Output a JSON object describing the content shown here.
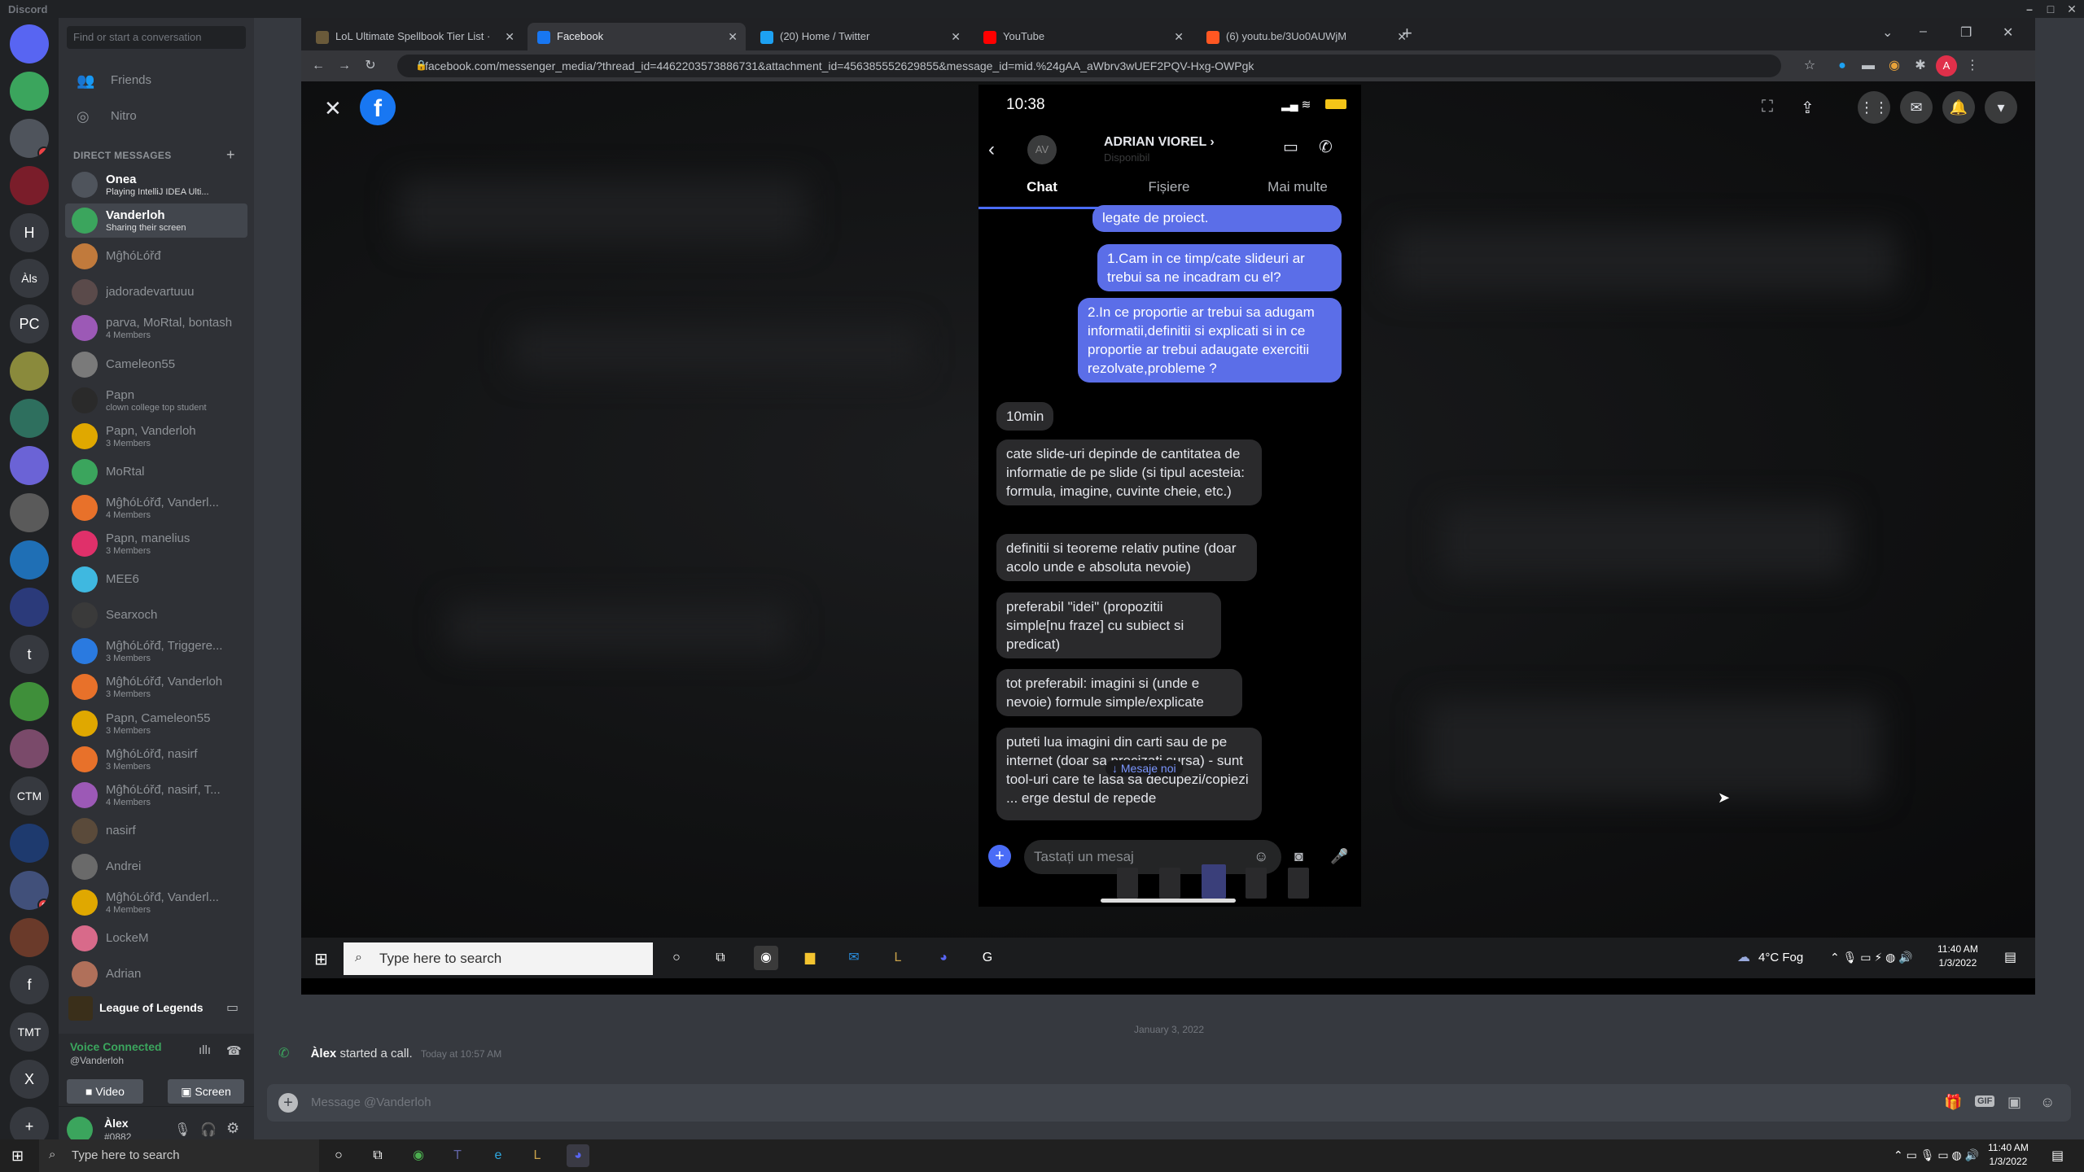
{
  "discord_title": "Discord",
  "dm_search_placeholder": "Find or start a conversation",
  "nav": [
    {
      "label": "Friends",
      "icon": "friends-icon"
    },
    {
      "label": "Nitro",
      "icon": "nitro-icon"
    }
  ],
  "dm_header": "DIRECT MESSAGES",
  "guilds": [
    {
      "label": "",
      "color": "#5865f2",
      "icon": "discord-home-icon"
    },
    {
      "label": "",
      "color": "#3ba55d",
      "icon": "server-icon"
    },
    {
      "label": "",
      "color": "#4f545c",
      "badge": "4"
    },
    {
      "label": "",
      "color": "#7a1d2a"
    },
    {
      "label": "H",
      "color": "#36393f"
    },
    {
      "label": "Àls",
      "color": "#36393f"
    },
    {
      "label": "PC",
      "color": "#36393f"
    },
    {
      "label": "",
      "color": "#8a8a3c"
    },
    {
      "label": "",
      "color": "#2e6f5e"
    },
    {
      "label": "",
      "color": "#6b63d6"
    },
    {
      "label": "",
      "color": "#5a5a5a"
    },
    {
      "label": "",
      "color": "#1f6fb5"
    },
    {
      "label": "",
      "color": "#2b3a7a"
    },
    {
      "label": "t",
      "color": "#36393f"
    },
    {
      "label": "",
      "color": "#3f8f3a"
    },
    {
      "label": "",
      "color": "#7a4a6a"
    },
    {
      "label": "CTM",
      "color": "#36393f"
    },
    {
      "label": "",
      "color": "#1e3a6e"
    },
    {
      "label": "",
      "color": "#41507a",
      "badge": "9"
    },
    {
      "label": "",
      "color": "#6a3a2a"
    },
    {
      "label": "f",
      "color": "#36393f"
    },
    {
      "label": "TMT",
      "color": "#36393f"
    },
    {
      "label": "X",
      "color": "#36393f"
    },
    {
      "label": "+",
      "color": "#36393f",
      "icon": "add-server-icon"
    }
  ],
  "dms": [
    {
      "name": "Onea",
      "sub": "Playing IntelliJ IDEA Ulti...",
      "color": "#4f545c",
      "hl": true
    },
    {
      "name": "Vanderloh",
      "sub": "Sharing their screen",
      "color": "#3ba55d",
      "active": true
    },
    {
      "name": "MĝħóĿóřđ",
      "sub": "",
      "color": "#c17a3c"
    },
    {
      "name": "jadoradevartuuu",
      "sub": "",
      "color": "#5a4a4a"
    },
    {
      "name": "parva, MoRtal, bontash",
      "sub": "4 Members",
      "color": "#9c59b6"
    },
    {
      "name": "Cameleon55",
      "sub": "",
      "color": "#7a7a7a"
    },
    {
      "name": "Papn",
      "sub": "clown college top student",
      "color": "#2a2a2a"
    },
    {
      "name": "Papn, Vanderloh",
      "sub": "3 Members",
      "color": "#e0a800"
    },
    {
      "name": "MoRtal",
      "sub": "",
      "color": "#3ba55d"
    },
    {
      "name": "MĝħóĿóřđ, Vanderl...",
      "sub": "4 Members",
      "color": "#e8712a"
    },
    {
      "name": "Papn, manelius",
      "sub": "3 Members",
      "color": "#e0306a"
    },
    {
      "name": "MEE6",
      "sub": "",
      "color": "#3fb8e0"
    },
    {
      "name": "Searxoch",
      "sub": "",
      "color": "#3a3a3a"
    },
    {
      "name": "MĝħóĿóřđ, Triggere...",
      "sub": "3 Members",
      "color": "#2a7ae0"
    },
    {
      "name": "MĝħóĿóřđ, Vanderloh",
      "sub": "3 Members",
      "color": "#e8712a"
    },
    {
      "name": "Papn, Cameleon55",
      "sub": "3 Members",
      "color": "#e0a800"
    },
    {
      "name": "MĝħóĿóřđ, nasirf",
      "sub": "3 Members",
      "color": "#e8712a"
    },
    {
      "name": "MĝħóĿóřđ, nasirf, T...",
      "sub": "4 Members",
      "color": "#9c59b6"
    },
    {
      "name": "nasirf",
      "sub": "",
      "color": "#5a4a3a"
    },
    {
      "name": "Andrei",
      "sub": "",
      "color": "#6a6a6a"
    },
    {
      "name": "MĝħóĿóřđ, Vanderl...",
      "sub": "4 Members",
      "color": "#e0a800"
    },
    {
      "name": "LockeM",
      "sub": "",
      "color": "#d86a8a"
    },
    {
      "name": "Adrian",
      "sub": "",
      "color": "#b0705a"
    }
  ],
  "game_row": "League of Legends",
  "voice": {
    "status": "Voice Connected",
    "channel": "@Vanderloh",
    "video": "Video",
    "screen": "Screen"
  },
  "user": {
    "name": "Àlex",
    "tag": "#0882"
  },
  "browser": {
    "tabs": [
      {
        "title": "LoL Ultimate Spellbook Tier List ·",
        "fav": "#6a5a3a"
      },
      {
        "title": "Facebook",
        "fav": "#1877f2",
        "active": true
      },
      {
        "title": "(20) Home / Twitter",
        "fav": "#1da1f2"
      },
      {
        "title": "YouTube",
        "fav": "#ff0000"
      },
      {
        "title": "(6) youtu.be/3Uo0AUWjM",
        "fav": "#ff5722"
      }
    ],
    "url": "facebook.com/messenger_media/?thread_id=4462203573886731&attachment_id=456385552629855&message_id=mid.%24gAA_aWbrv3wUEF2PQV-Hxg-OWPgk"
  },
  "phone": {
    "time": "10:38",
    "contact": "ADRIAN VIOREL ›",
    "initials": "AV",
    "status": "Disponibil",
    "tabs": [
      "Chat",
      "Fișiere",
      "Mai multe"
    ],
    "sent": [
      "legate de proiect.",
      "1.Cam in ce timp/cate slideuri ar trebui sa ne incadram cu el?",
      "2.In ce proportie ar trebui sa adugam informatii,definitii si explicati si in ce proportie ar trebui adaugate exercitii rezolvate,probleme ?"
    ],
    "received": [
      "10min",
      "cate slide-uri depinde de cantitatea de informatie de pe slide (si tipul acesteia: formula, imagine, cuvinte cheie, etc.)",
      "definitii si teoreme relativ putine (doar acolo unde e absoluta nevoie)",
      "preferabil \"idei\" (propozitii simple[nu fraze] cu subiect si predicat)",
      "tot preferabil: imagini si (unde e nevoie) formule simple/explicate",
      "puteti lua imagini din carti sau de pe internet (doar sa precizati sursa) - sunt tool-uri care te lasa sa decupezi/copiezi ... erge destul de repede"
    ],
    "new_messages": "↓ Mesaje noi",
    "composer_placeholder": "Tastați un mesaj"
  },
  "inner_taskbar": {
    "search": "Type here to search",
    "weather": "4°C  Fog",
    "time": "11:40 AM",
    "date": "1/3/2022"
  },
  "chat": {
    "date_divider": "January 3, 2022",
    "call_author": "Àlex",
    "call_text": "started a call.",
    "call_time": "Today at 10:57 AM",
    "placeholder": "Message @Vanderloh"
  },
  "os_taskbar": {
    "search": "Type here to search",
    "time": "11:40 AM",
    "date": "1/3/2022"
  }
}
